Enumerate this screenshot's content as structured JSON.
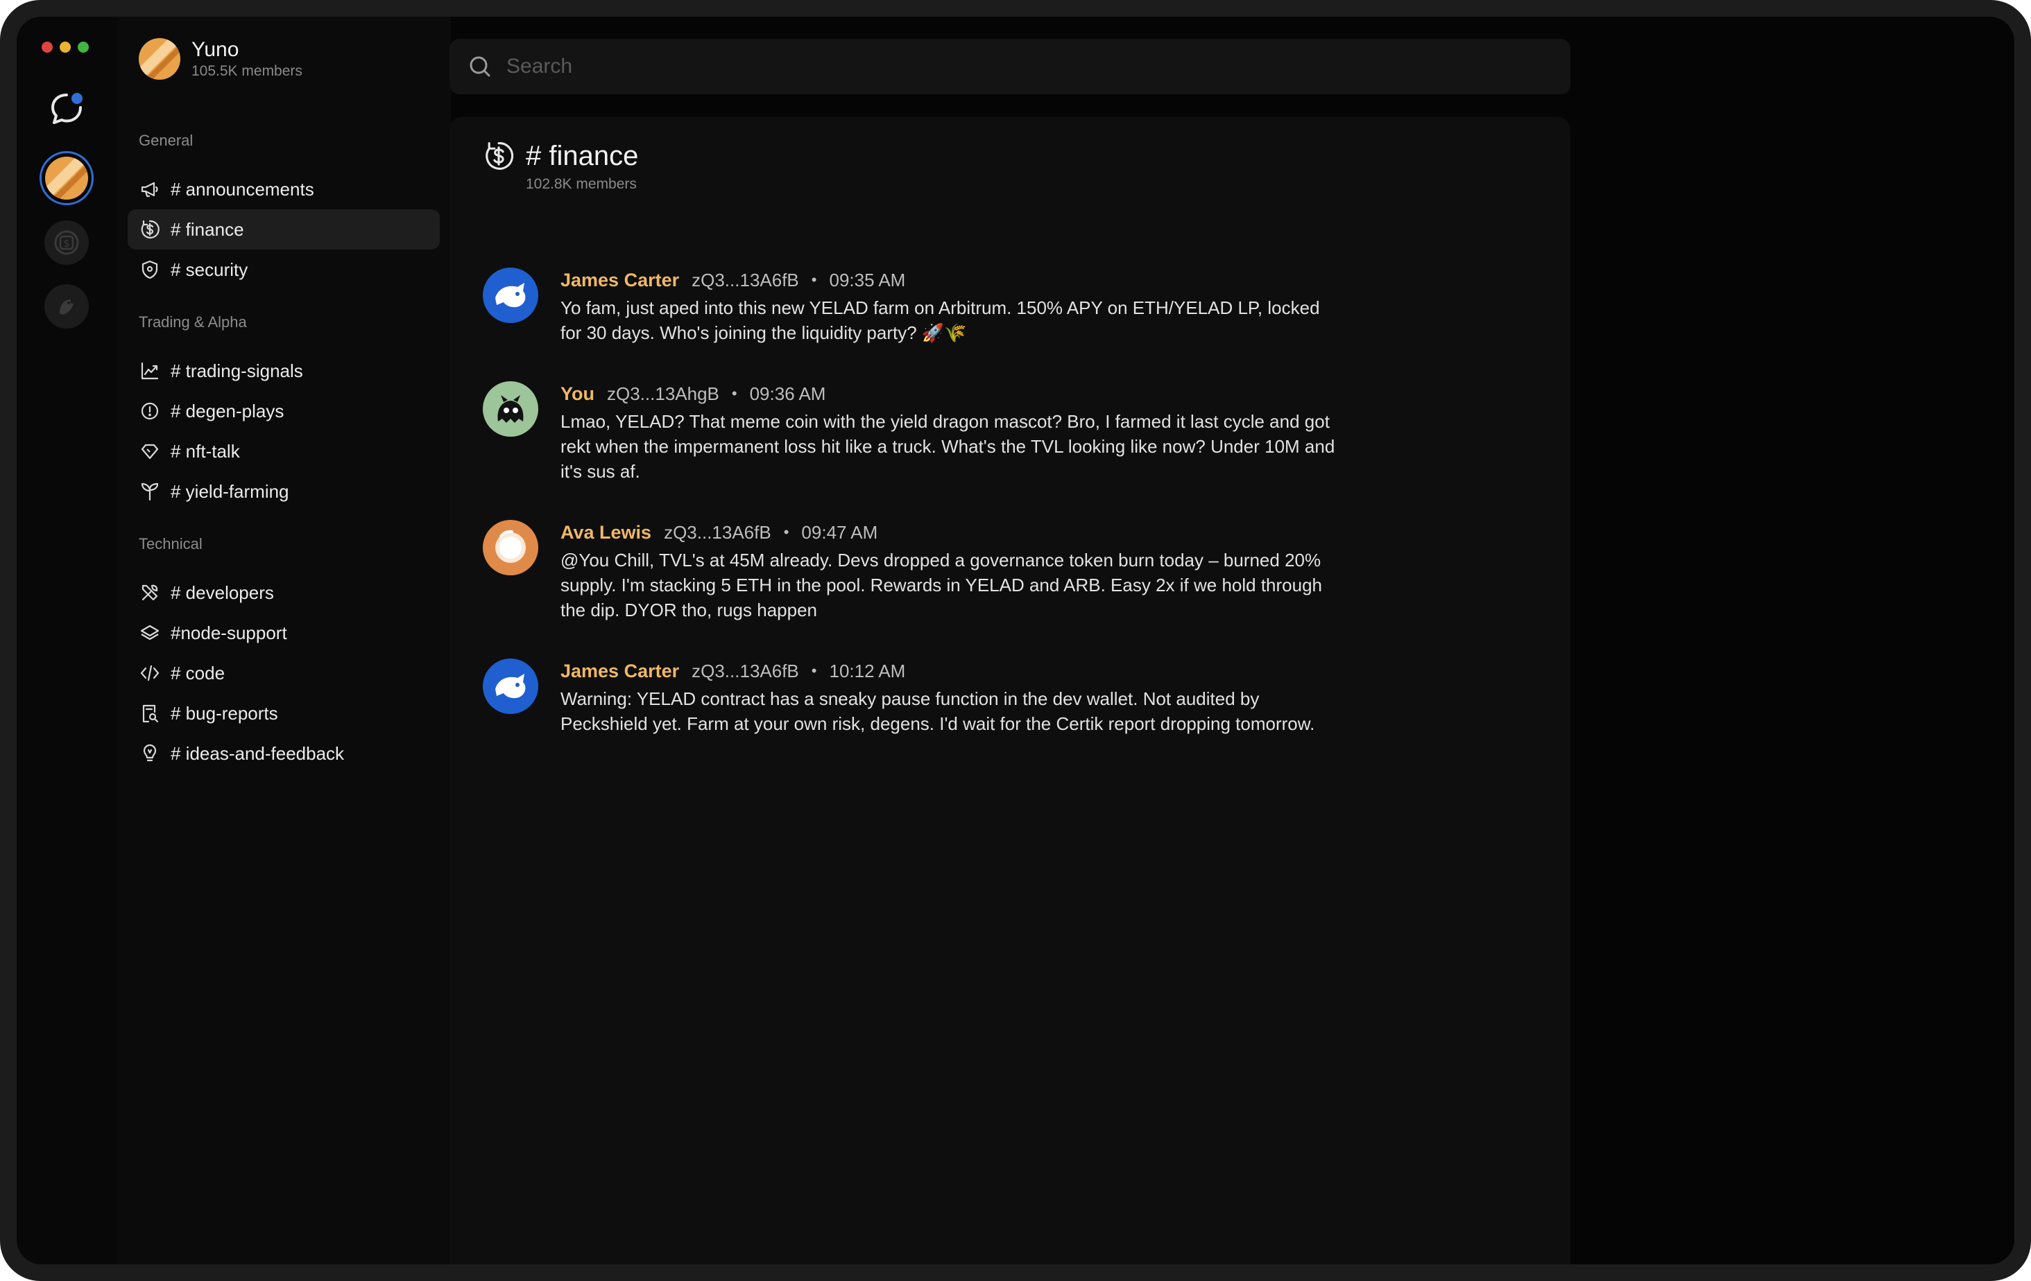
{
  "window": {
    "controls": {
      "close": "#e0443e",
      "minimize": "#e8b52d",
      "maximize": "#3fb542"
    }
  },
  "rail": {
    "items": [
      {
        "icon": "chat-bubble-icon",
        "badge_color": "#2f6fd6"
      },
      {
        "icon": "server-yuno-icon",
        "active": true
      },
      {
        "icon": "server-coin-icon"
      },
      {
        "icon": "server-bird-icon"
      }
    ]
  },
  "server": {
    "name": "Yuno",
    "members": "105.5K members"
  },
  "sections": [
    {
      "title": "General",
      "channels": [
        {
          "label": "# announcements",
          "icon": "megaphone-icon"
        },
        {
          "label": "# finance",
          "icon": "dollar-circle-icon",
          "active": true
        },
        {
          "label": "# security",
          "icon": "shield-icon"
        }
      ]
    },
    {
      "title": "Trading & Alpha",
      "channels": [
        {
          "label": "# trading-signals",
          "icon": "chart-line-icon"
        },
        {
          "label": "# degen-plays",
          "icon": "alert-circle-icon"
        },
        {
          "label": "# nft-talk",
          "icon": "diamond-icon"
        },
        {
          "label": "# yield-farming",
          "icon": "sprout-icon"
        }
      ]
    },
    {
      "title": "Technical",
      "channels": [
        {
          "label": "# developers",
          "icon": "tools-icon"
        },
        {
          "label": "#node-support",
          "icon": "layers-icon"
        },
        {
          "label": "# code",
          "icon": "code-icon"
        },
        {
          "label": "# bug-reports",
          "icon": "file-search-icon"
        },
        {
          "label": "# ideas-and-feedback",
          "icon": "lightbulb-icon"
        }
      ]
    }
  ],
  "search": {
    "placeholder": "Search"
  },
  "channel": {
    "title": "# finance",
    "members": "102.8K members",
    "icon": "dollar-circle-icon"
  },
  "messages": [
    {
      "name": "James Carter",
      "address": "zQ3...13A6fB",
      "time": "09:35 AM",
      "avatar": "blue-dragon-avatar",
      "text": "Yo fam, just aped into this new YELAD farm on Arbitrum. 150% APY on ETH/YELAD LP, locked for 30 days. Who's joining the liquidity party? 🚀🌾"
    },
    {
      "name": "You",
      "address": "zQ3...13AhgB",
      "time": "09:36 AM",
      "avatar": "green-monster-avatar",
      "text": "Lmao, YELAD? That meme coin with the yield dragon mascot? Bro, I farmed it last cycle and got rekt when the impermanent loss hit like a truck. What's the TVL looking like now? Under 10M and it's sus af."
    },
    {
      "name": "Ava Lewis",
      "address": "zQ3...13A6fB",
      "time": "09:47 AM",
      "avatar": "orange-astronaut-avatar",
      "text": "@You Chill, TVL's at 45M already. Devs dropped a governance token burn today – burned 20% supply. I'm stacking 5 ETH in the pool. Rewards in YELAD and ARB. Easy 2x if we hold through the dip. DYOR tho, rugs happen"
    },
    {
      "name": "James Carter",
      "address": "zQ3...13A6fB",
      "time": "10:12 AM",
      "avatar": "blue-dragon-avatar",
      "text": "Warning: YELAD contract has a sneaky pause function in the dev wallet. Not audited by Peckshield yet. Farm at your own risk, degens. I'd wait for the Certik report dropping tomorrow."
    }
  ],
  "colors": {
    "accent_name": "#f0b865",
    "active_ring": "#2f6fd6",
    "panel": "#0e0e0e"
  }
}
